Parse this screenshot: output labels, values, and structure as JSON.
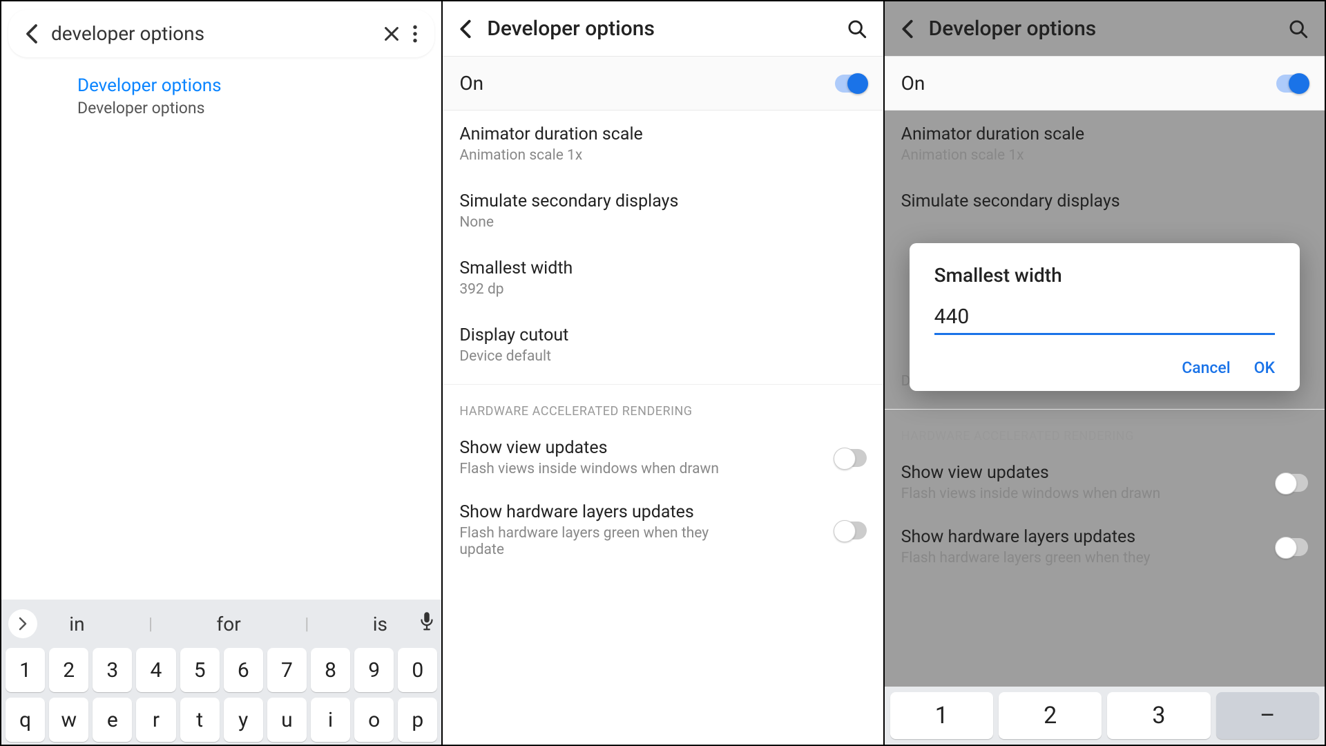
{
  "panel1": {
    "search_value": "developer options",
    "result_title": "Developer options",
    "result_sub": "Developer options",
    "suggestions": [
      "in",
      "for",
      "is"
    ],
    "row_num": [
      "1",
      "2",
      "3",
      "4",
      "5",
      "6",
      "7",
      "8",
      "9",
      "0"
    ],
    "row_qwe": [
      "q",
      "w",
      "e",
      "r",
      "t",
      "y",
      "u",
      "i",
      "o",
      "p"
    ]
  },
  "panel2": {
    "title": "Developer options",
    "on_label": "On",
    "items": [
      {
        "title": "Animator duration scale",
        "sub": "Animation scale 1x"
      },
      {
        "title": "Simulate secondary displays",
        "sub": "None"
      },
      {
        "title": "Smallest width",
        "sub": "392 dp"
      },
      {
        "title": "Display cutout",
        "sub": "Device default"
      }
    ],
    "section": "HARDWARE ACCELERATED RENDERING",
    "toggles": [
      {
        "title": "Show view updates",
        "sub": "Flash views inside windows when drawn"
      },
      {
        "title": "Show hardware layers updates",
        "sub": "Flash hardware layers green when they update"
      }
    ]
  },
  "panel3": {
    "title": "Developer options",
    "on_label": "On",
    "items": [
      {
        "title": "Animator duration scale",
        "sub": "Animation scale 1x"
      },
      {
        "title": "Simulate secondary displays",
        "sub": ""
      }
    ],
    "cutout_sub": "Device default",
    "section": "HARDWARE ACCELERATED RENDERING",
    "toggles": [
      {
        "title": "Show view updates",
        "sub": "Flash views inside windows when drawn"
      },
      {
        "title": "Show hardware layers updates",
        "sub": "Flash hardware layers green when they"
      }
    ],
    "dialog": {
      "title": "Smallest width",
      "value": "440",
      "cancel": "Cancel",
      "ok": "OK"
    },
    "numpad": [
      "1",
      "2",
      "3",
      "–"
    ]
  }
}
